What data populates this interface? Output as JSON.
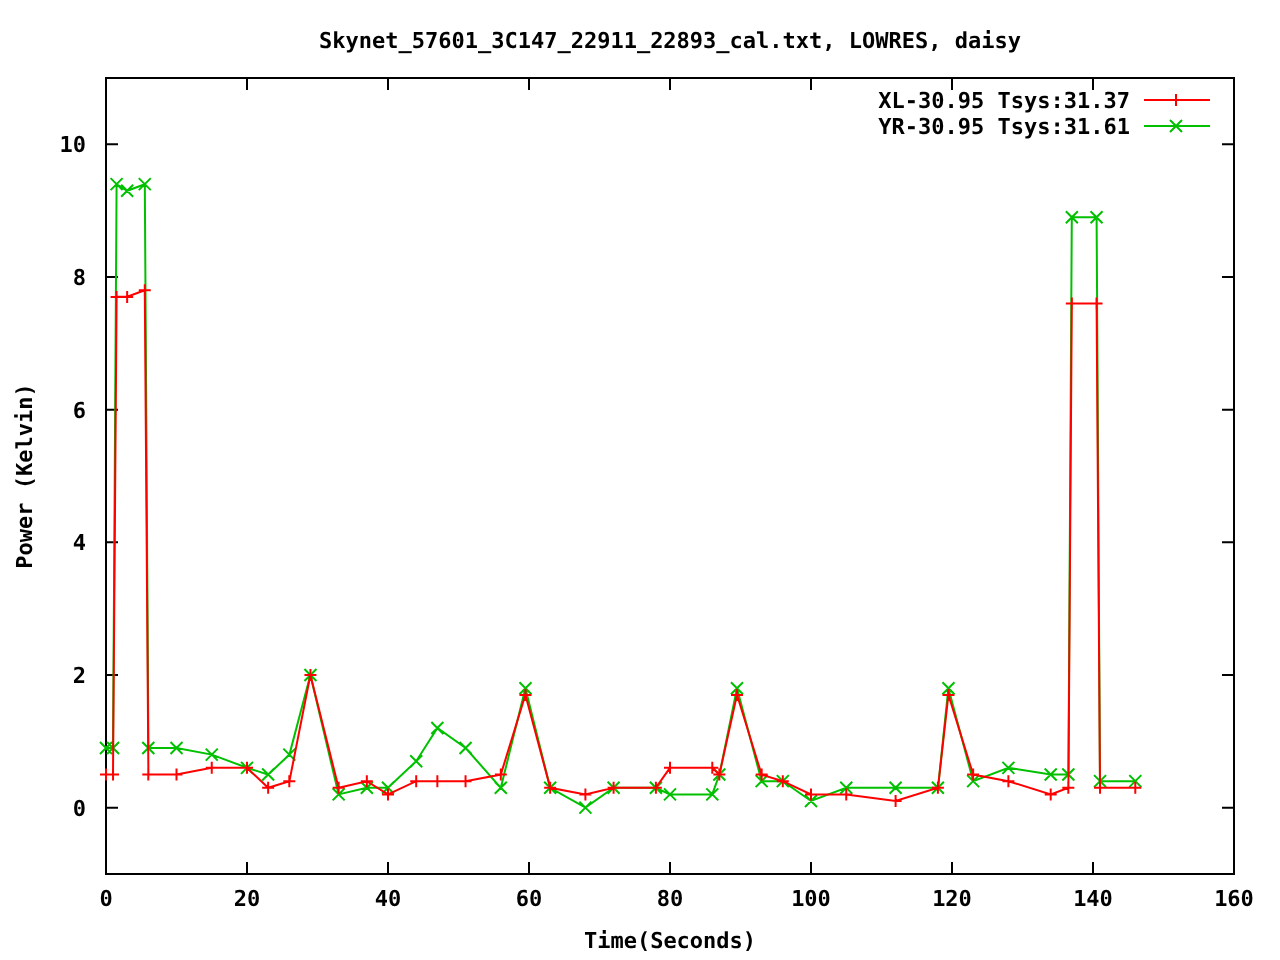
{
  "chart": {
    "chart_data": {
      "type": "line",
      "title": "Skynet_57601_3C147_22911_22893_cal.txt, LOWRES, daisy",
      "xlabel": "Time(Seconds)",
      "ylabel": "Power (Kelvin)",
      "x": [
        0,
        1,
        1.5,
        3,
        5.5,
        6,
        10,
        15,
        20,
        23,
        26,
        29,
        33,
        37,
        40,
        44,
        47,
        51,
        56,
        59.5,
        63,
        68,
        72,
        78,
        80,
        86,
        87,
        89.5,
        93,
        96,
        100,
        105,
        112,
        118,
        119.5,
        123,
        128,
        134,
        136.5,
        137,
        140.5,
        141,
        146
      ],
      "series": [
        {
          "name": "XL-30.95 Tsys:31.37",
          "color": "#ff0000",
          "marker": "plus",
          "values": [
            0.5,
            0.5,
            7.7,
            7.7,
            7.8,
            0.5,
            0.5,
            0.6,
            0.6,
            0.3,
            0.4,
            2.0,
            0.3,
            0.4,
            0.2,
            0.4,
            0.4,
            0.4,
            0.5,
            1.7,
            0.3,
            0.2,
            0.3,
            0.3,
            0.6,
            0.6,
            0.5,
            1.7,
            0.5,
            0.4,
            0.2,
            0.2,
            0.1,
            0.3,
            1.7,
            0.5,
            0.4,
            0.2,
            0.3,
            7.6,
            7.6,
            0.3,
            0.3
          ]
        },
        {
          "name": "YR-30.95 Tsys:31.61",
          "color": "#00c000",
          "marker": "cross",
          "values": [
            0.9,
            0.9,
            9.4,
            9.3,
            9.4,
            0.9,
            0.9,
            0.8,
            0.6,
            0.5,
            0.8,
            2.0,
            0.2,
            0.3,
            0.3,
            0.7,
            1.2,
            0.9,
            0.3,
            1.8,
            0.3,
            0.0,
            0.3,
            0.3,
            0.2,
            0.2,
            0.5,
            1.8,
            0.4,
            0.4,
            0.1,
            0.3,
            0.3,
            0.3,
            1.8,
            0.4,
            0.6,
            0.5,
            0.5,
            8.9,
            8.9,
            0.4,
            0.4
          ]
        }
      ],
      "legend": true,
      "xlim": [
        0,
        160
      ],
      "ylim": [
        -1,
        11
      ],
      "xticks": [
        0,
        20,
        40,
        60,
        80,
        100,
        120,
        140,
        160
      ],
      "yticks": [
        0,
        2,
        4,
        6,
        8,
        10
      ]
    }
  }
}
